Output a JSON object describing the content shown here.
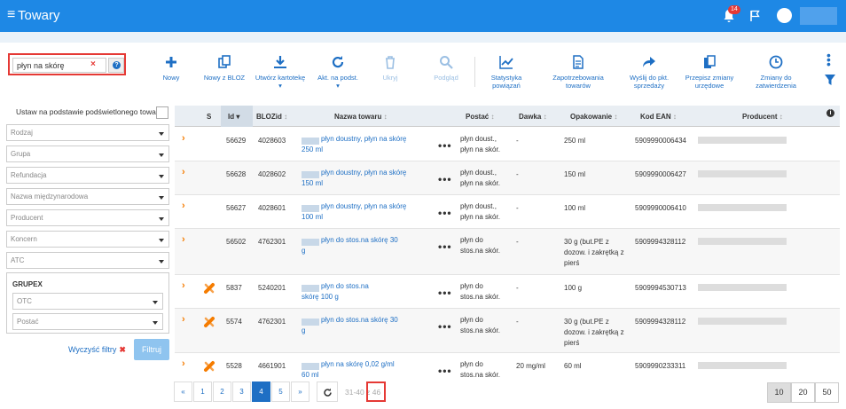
{
  "header": {
    "title": "Towary",
    "notif_count": "14"
  },
  "search": {
    "value": "płyn na skórę",
    "clear": "×",
    "help": "?"
  },
  "toolbar": {
    "new": "Nowy",
    "new_from_bloz": "Nowy z BLOZ",
    "create_card": "Utwórz kartotekę",
    "update_basis": "Akt. na podst.",
    "hide": "Ukryj",
    "preview": "Podgląd",
    "stats": "Statystyka powiązań",
    "demand": "Zapotrzebowania towarów",
    "send_to_point": "Wyślij do pkt. sprzedaży",
    "rewrite_office": "Przepisz zmiany urzędowe",
    "approve": "Zmiany do zatwierdzenia"
  },
  "filters": {
    "set_based": "Ustaw na podstawie podświetlonego towaru",
    "rodzaj": "Rodzaj",
    "grupa": "Grupa",
    "refundacja": "Refundacja",
    "nazwa_miedzynarodowa": "Nazwa międzynarodowa",
    "producent": "Producent",
    "koncern": "Koncern",
    "atc": "ATC",
    "grupex": "GRUPEX",
    "otc": "OTC",
    "postac": "Postać",
    "clear": "Wyczyść filtry",
    "filter_btn": "Filtruj"
  },
  "table": {
    "columns": {
      "s": "S",
      "id": "Id",
      "blozid": "BLOZid",
      "name": "Nazwa towaru",
      "form": "Postać",
      "dose": "Dawka",
      "package": "Opakowanie",
      "ean": "Kod EAN",
      "producer": "Producent"
    },
    "rows": [
      {
        "id": "56629",
        "bloz": "4028603",
        "name1": "płyn doustny, płyn na skórę",
        "name2": "250 ml",
        "form1": "płyn doust.,",
        "form2": "płyn na skór.",
        "dose": "-",
        "pack1": "250 ml",
        "pack2": "",
        "pack3": "",
        "ean": "5909990006434",
        "blaz": false
      },
      {
        "id": "56628",
        "bloz": "4028602",
        "name1": "płyn doustny, płyn na skórę",
        "name2": "150 ml",
        "form1": "płyn doust.,",
        "form2": "płyn na skór.",
        "dose": "-",
        "pack1": "150 ml",
        "pack2": "",
        "pack3": "",
        "ean": "5909990006427",
        "blaz": false
      },
      {
        "id": "56627",
        "bloz": "4028601",
        "name1": "płyn doustny, płyn na skórę",
        "name2": "100 ml",
        "form1": "płyn doust.,",
        "form2": "płyn na skór.",
        "dose": "-",
        "pack1": "100 ml",
        "pack2": "",
        "pack3": "",
        "ean": "5909990006410",
        "blaz": false
      },
      {
        "id": "56502",
        "bloz": "4762301",
        "name1": "płyn do stos.na skórę 30",
        "name2": "g",
        "form1": "płyn do",
        "form2": "stos.na skór.",
        "dose": "-",
        "pack1": "30 g (but.PE z",
        "pack2": "dozow. i zakrętką z",
        "pack3": "pierś",
        "ean": "5909994328112",
        "blaz": false
      },
      {
        "id": "5837",
        "bloz": "5240201",
        "name1": "płyn do stos.na",
        "name2": "skórę 100 g",
        "form1": "płyn do",
        "form2": "stos.na skór.",
        "dose": "-",
        "pack1": "100 g",
        "pack2": "",
        "pack3": "",
        "ean": "5909994530713",
        "blaz": true
      },
      {
        "id": "5574",
        "bloz": "4762301",
        "name1": "płyn do stos.na skórę 30",
        "name2": "g",
        "form1": "płyn do",
        "form2": "stos.na skór.",
        "dose": "-",
        "pack1": "30 g (but.PE z",
        "pack2": "dozow. i zakrętką z",
        "pack3": "pierś",
        "ean": "5909994328112",
        "blaz": true
      },
      {
        "id": "5528",
        "bloz": "4661901",
        "name1": "płyn na skórę 0,02 g/ml",
        "name2": "60 ml",
        "form1": "płyn do",
        "form2": "stos.na skór.",
        "dose": "20 mg/ml",
        "pack1": "60 ml",
        "pack2": "",
        "pack3": "",
        "ean": "5909990233311",
        "blaz": true
      }
    ]
  },
  "pager": {
    "prev": "«",
    "p1": "1",
    "p2": "2",
    "p3": "3",
    "p4": "4",
    "p5": "5",
    "next": "»",
    "range": "31-40 z 46",
    "size10": "10",
    "size20": "20",
    "size50": "50"
  },
  "colors": {
    "primary": "#1e88e5",
    "link": "#1e6fc4",
    "accent": "#f57c00",
    "highlight": "#e53935"
  }
}
